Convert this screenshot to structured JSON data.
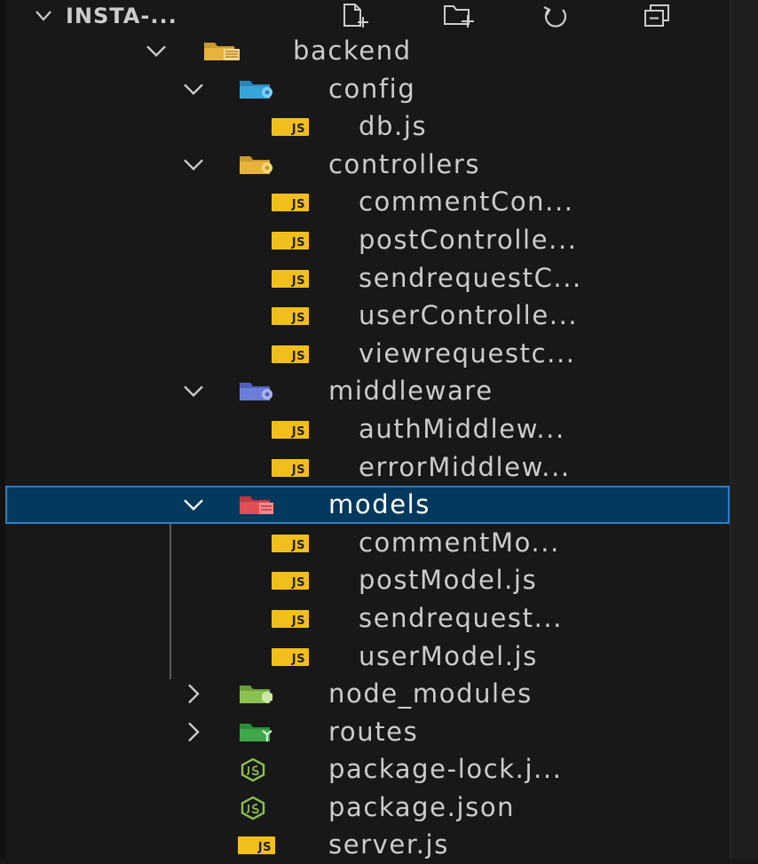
{
  "explorer": {
    "section_title": "INSTA-...",
    "toolbar": {
      "new_file": "new-file-icon",
      "new_folder": "new-folder-icon",
      "refresh": "refresh-icon",
      "collapse": "collapse-all-icon"
    }
  },
  "tree": {
    "backend": "backend",
    "config": "config",
    "db": "db.js",
    "controllers": "controllers",
    "commentController": "commentCon...",
    "postController": "postControlle...",
    "sendrequestController": "sendrequestC...",
    "userController": "userControlle...",
    "viewrequestController": "viewrequestc...",
    "middleware": "middleware",
    "authMiddleware": "authMiddlew...",
    "errorMiddleware": "errorMiddlew...",
    "models": "models",
    "commentModel": "commentMo...",
    "postModel": "postModel.js",
    "sendrequestModel": "sendrequest...",
    "userModel": "userModel.js",
    "node_modules": "node_modules",
    "routes": "routes",
    "package_lock": "package-lock.j...",
    "package_json": "package.json",
    "server": "server.js"
  },
  "badge": {
    "js": "JS"
  },
  "colors": {
    "background": "#181818",
    "selection": "#04395e",
    "selection_border": "#2f7dc4",
    "js_badge": "#f1bf1c",
    "folder_yellow": "#e8b33c",
    "config_blue": "#3aa3d8",
    "middleware_purple": "#6a7dd8",
    "models_red": "#e04e56",
    "node_green": "#8cc152",
    "routes_green": "#3fa64a"
  }
}
